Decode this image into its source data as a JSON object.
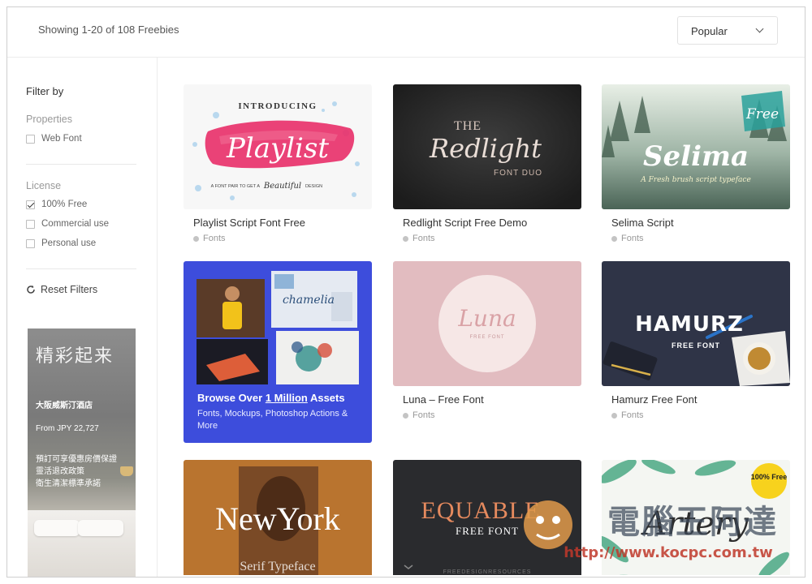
{
  "header": {
    "result_count": "Showing 1-20 of 108 Freebies",
    "sort_selected": "Popular"
  },
  "sidebar": {
    "filter_title": "Filter by",
    "groups": [
      {
        "title": "Properties",
        "options": [
          {
            "label": "Web Font",
            "checked": false
          }
        ]
      },
      {
        "title": "License",
        "options": [
          {
            "label": "100% Free",
            "checked": true
          },
          {
            "label": "Commercial use",
            "checked": false
          },
          {
            "label": "Personal use",
            "checked": false
          }
        ]
      }
    ],
    "reset_label": "Reset Filters"
  },
  "ad": {
    "title": "精彩起来",
    "hotel": "大阪威斯汀酒店",
    "price": "From JPY 22,727",
    "lines": [
      "預訂可享優惠房價保證",
      "靈活退改政策",
      "衛生清潔標準承諾"
    ]
  },
  "cards": [
    {
      "name": "Playlist Script Font Free",
      "category": "Fonts",
      "art": {
        "top": "INTRODUCING",
        "main": "Playlist",
        "bottom": "A FONT PAIR TO GET A",
        "bottom2": "Beautiful",
        "bottom3": "DESIGN"
      }
    },
    {
      "name": "Redlight Script Free Demo",
      "category": "Fonts",
      "art": {
        "top": "THE",
        "main": "Redlight",
        "bottom": "FONT DUO"
      }
    },
    {
      "name": "Selima Script",
      "category": "Fonts",
      "art": {
        "badge": "Free",
        "main": "Selima",
        "bottom": "A Fresh brush script typeface"
      }
    },
    {
      "name": "Luna – Free Font",
      "category": "Fonts",
      "art": {
        "main": "Luna",
        "bottom": "FREE FONT"
      }
    },
    {
      "name": "Hamurz Free Font",
      "category": "Fonts",
      "art": {
        "main": "HAMURZ",
        "bottom": "FREE FONT"
      }
    },
    {
      "art": {
        "main": "NewYork",
        "bottom": "Serif Typeface"
      }
    },
    {
      "art": {
        "main": "EQUABLE",
        "bottom": "FREE FONT",
        "footer": "FREEDESIGNRESOURCES"
      }
    },
    {
      "art": {
        "badge": "100% Free",
        "main": "Artery"
      }
    }
  ],
  "promo": {
    "heading_prefix": "Browse Over ",
    "heading_link": "1 Million",
    "heading_suffix": " Assets",
    "sub": "Fonts, Mockups, Photoshop Actions & More",
    "collage_label": "chamelia"
  },
  "watermark": {
    "title": "電腦王阿達",
    "url": "http://www.kocpc.com.tw"
  },
  "colors": {
    "promo_bg": "#3d4ddc",
    "luna_bg": "#e2bcc0",
    "hamurz_bg": "#2f3447",
    "redlight_bg": "#2b2b2b",
    "newyork_bg": "#b9742f",
    "equable_bg": "#2a2b2e"
  }
}
